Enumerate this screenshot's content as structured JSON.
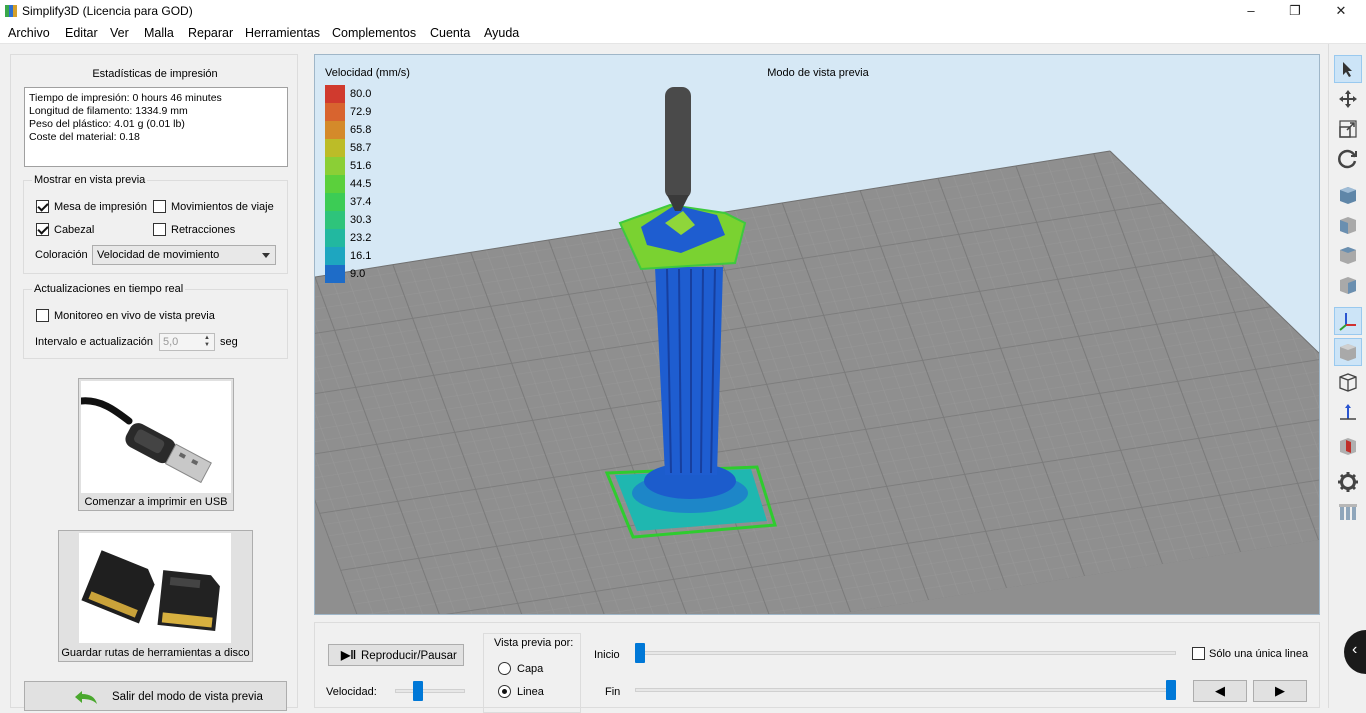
{
  "window": {
    "title": "Simplify3D (Licencia para GOD)",
    "minimize": "–",
    "maximize": "❐",
    "close": "✕"
  },
  "menu": [
    "Archivo",
    "Editar",
    "Ver",
    "Malla",
    "Reparar",
    "Herramientas",
    "Complementos",
    "Cuenta",
    "Ayuda"
  ],
  "stats": {
    "title": "Estadísticas de impresión",
    "lines": [
      "Tiempo de impresión: 0 hours 46 minutes",
      "Longitud de filamento: 1334.9 mm",
      "Peso del plástico: 4.01 g (0.01 lb)",
      "Coste del material: 0.18"
    ]
  },
  "preview_options": {
    "title": "Mostrar en vista previa",
    "bed": {
      "label": "Mesa de impresión",
      "checked": true
    },
    "travel": {
      "label": "Movimientos de viaje",
      "checked": false
    },
    "head": {
      "label": "Cabezal",
      "checked": true
    },
    "retractions": {
      "label": "Retracciones",
      "checked": false
    },
    "coloring_label": "Coloración",
    "coloring_value": "Velocidad de movimiento"
  },
  "realtime": {
    "title": "Actualizaciones en tiempo real",
    "monitor": {
      "label": "Monitoreo en vivo de vista previa",
      "checked": false
    },
    "interval_label": "Intervalo e actualización",
    "interval_value": "5,0",
    "unit": "seg"
  },
  "usb_button": {
    "label": "Comenzar a imprimir en USB"
  },
  "sd_button": {
    "label": "Guardar rutas de herramientas a disco"
  },
  "exit_button": {
    "label": "Salir del modo de vista previa"
  },
  "viewport": {
    "mode_title": "Modo de vista previa",
    "legend_title": "Velocidad (mm/s)",
    "legend": [
      {
        "value": "80.0",
        "color": "#d03a2e"
      },
      {
        "value": "72.9",
        "color": "#d8642f"
      },
      {
        "value": "65.8",
        "color": "#d48a2a"
      },
      {
        "value": "58.7",
        "color": "#bcbc28"
      },
      {
        "value": "51.6",
        "color": "#8bcf36"
      },
      {
        "value": "44.5",
        "color": "#5bd03c"
      },
      {
        "value": "37.4",
        "color": "#3ccc55"
      },
      {
        "value": "30.3",
        "color": "#2ec47b"
      },
      {
        "value": "23.2",
        "color": "#22b8a0"
      },
      {
        "value": "16.1",
        "color": "#1ea6c0"
      },
      {
        "value": "9.0",
        "color": "#1e6cc8"
      }
    ]
  },
  "playback": {
    "play_label": "Reproducir/Pausar",
    "speed_label": "Velocidad:",
    "speed_level": 0.3,
    "preview_by_title": "Vista previa por:",
    "layer_label": "Capa",
    "line_label": "Linea",
    "selected": "line",
    "start_label": "Inicio",
    "start_level": 0.0,
    "end_label": "Fin",
    "end_level": 1.0,
    "single_line_label": "Sólo una única linea",
    "single_line_checked": false,
    "prev": "◀",
    "next": "▶"
  },
  "toolbar": [
    "select-icon",
    "move-icon",
    "scale-icon",
    "rotate-icon",
    "view-default-icon",
    "view-front-icon",
    "view-top-icon",
    "view-side-icon",
    "axes-icon",
    "solid-view-icon",
    "wireframe-icon",
    "normals-icon",
    "cross-section-icon",
    "settings-icon",
    "supports-icon"
  ]
}
